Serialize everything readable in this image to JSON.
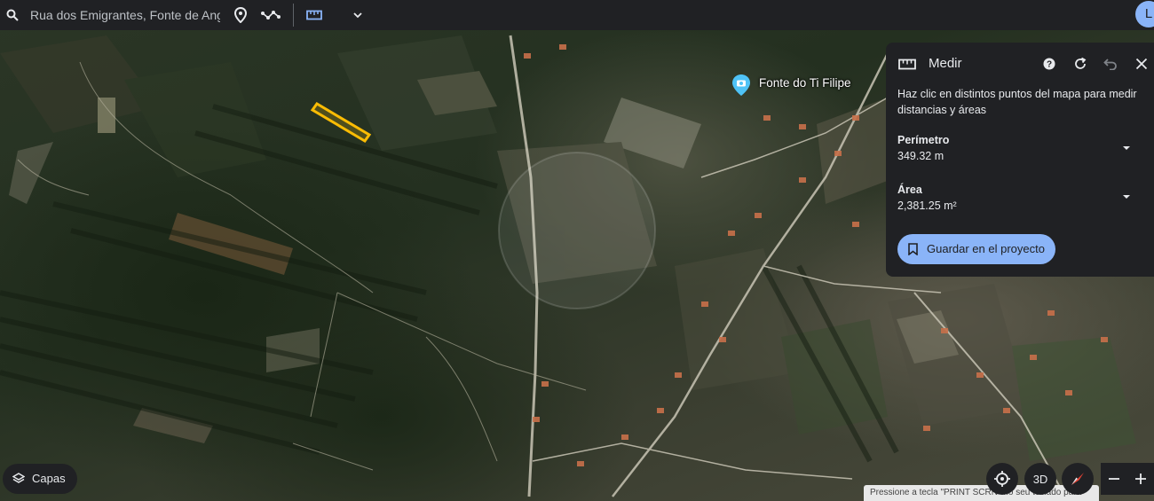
{
  "search": {
    "value": "Rua dos Emigrantes, Fonte de Ang"
  },
  "icons": {
    "search": "search-icon",
    "place_pin": "place-pin-icon",
    "route": "route-icon",
    "ruler": "ruler-icon",
    "dropdown": "chevron-down-icon"
  },
  "user": {
    "avatar_initial": "L"
  },
  "measure_panel": {
    "title": "Medir",
    "description": "Haz clic en distintos puntos del mapa para medir distancias y áreas",
    "perimeter_label": "Perímetro",
    "perimeter_value": "349.32 m",
    "area_label": "Área",
    "area_value": "2,381.25 m²",
    "save_label": "Guardar en el proyecto"
  },
  "map": {
    "place_label": "Fonte do Ti Filipe",
    "measured_shape_color": "#fbbc04"
  },
  "controls": {
    "layers_label": "Capas",
    "view_3d_label": "3D"
  },
  "toast": {
    "text": "Pressione a tecla \"PRINT SCRN\" no seu teclado para"
  },
  "colors": {
    "bar_bg": "#202124",
    "accent": "#8ab4f8",
    "place_pin": "#4fc3f7"
  }
}
